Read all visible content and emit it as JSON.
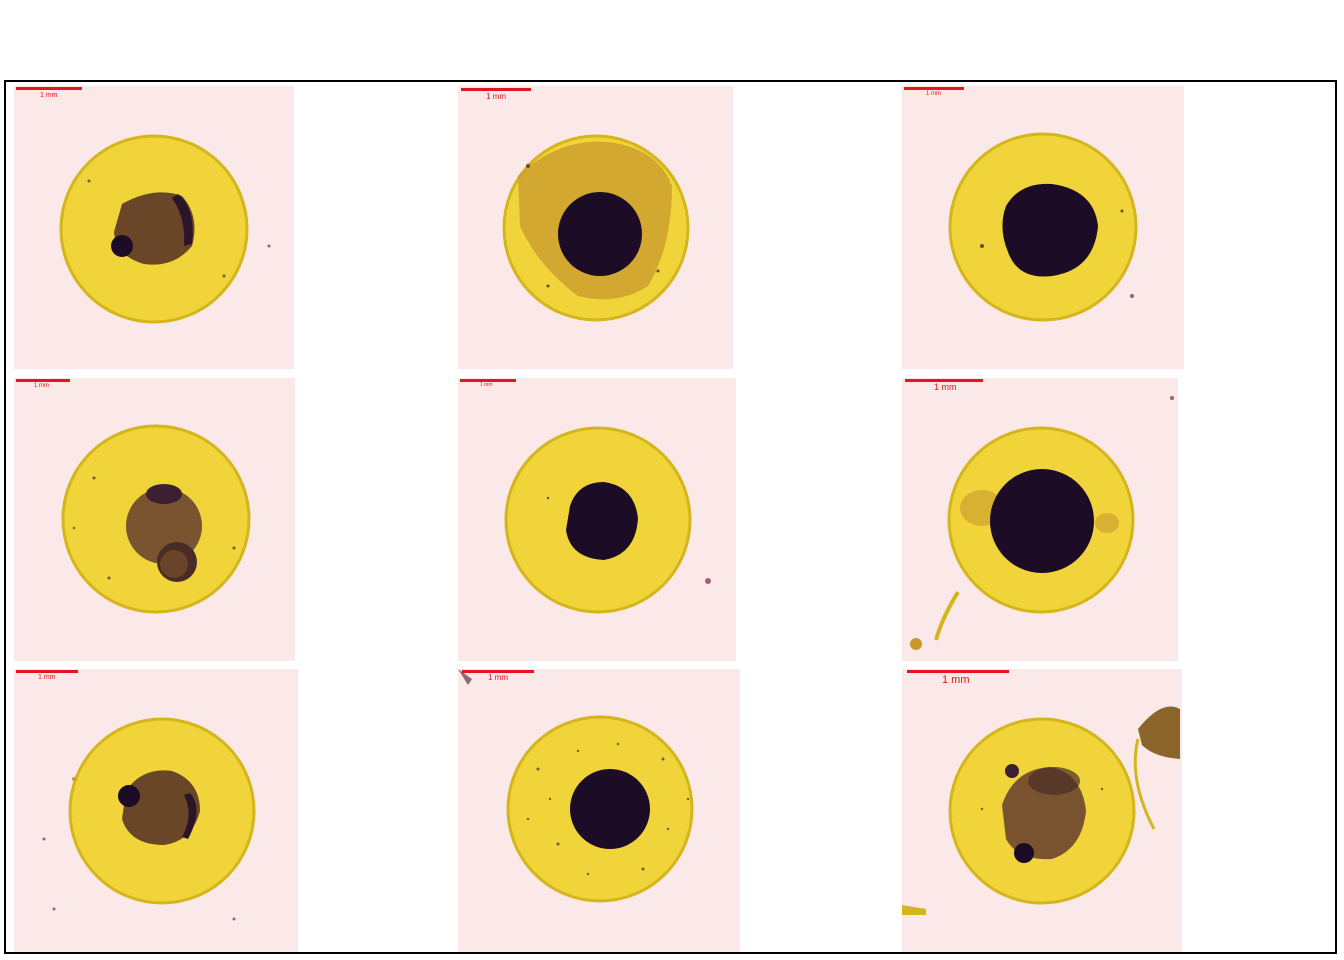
{
  "colors": {
    "background": "#fbe9ea",
    "yolk_ring": "#e2c620",
    "yolk_fill": "#f0d43a",
    "embryo_dark": "#1c0c26",
    "embryo_brown": "#6a4628",
    "scale_bar": "#e8141b"
  },
  "panels": [
    {
      "scale_label": "1 mm",
      "embryo": "irregular-brown"
    },
    {
      "scale_label": "1 mm",
      "embryo": "dark-round-with-halo"
    },
    {
      "scale_label": "1 mm",
      "embryo": "dark-round-large"
    },
    {
      "scale_label": "1 mm",
      "embryo": "brown-two-lobes"
    },
    {
      "scale_label": "1 mm",
      "embryo": "dark-round-small"
    },
    {
      "scale_label": "1 mm",
      "embryo": "dark-round-large"
    },
    {
      "scale_label": "1 mm",
      "embryo": "irregular-brown"
    },
    {
      "scale_label": "1 mm",
      "embryo": "dark-round-speckled"
    },
    {
      "scale_label": "1 mm",
      "embryo": "brown-oval-with-debris"
    }
  ]
}
